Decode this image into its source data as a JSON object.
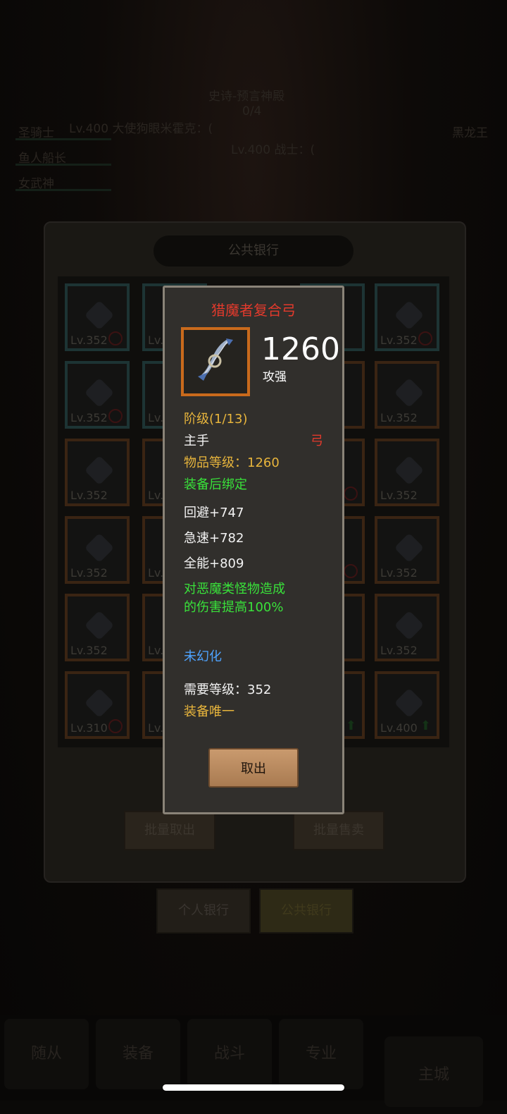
{
  "background": {
    "dungeon_title": "史诗-预言神殿",
    "dungeon_progress": "0/4",
    "boss_line_1": "Lv.400 大使狗眼米霍克：(",
    "boss_line_2": "Lv.400 战士：(",
    "right_label": "黑龙王",
    "party": [
      "圣骑士",
      "鱼人船长",
      "女武神"
    ]
  },
  "bank": {
    "title": "公共银行",
    "cells": [
      {
        "lv": "Lv.352",
        "ban": true,
        "border": "teal"
      },
      {
        "lv": "Lv.352",
        "ban": true,
        "border": "teal"
      },
      {
        "lv": "Lv.352",
        "ban": true,
        "border": "teal"
      },
      {
        "lv": "Lv.352",
        "ban": false,
        "border": "orange"
      },
      {
        "lv": "Lv.352",
        "ban": false,
        "border": "orange"
      },
      {
        "lv": "Lv.352",
        "ban": false,
        "border": "orange"
      },
      {
        "lv": "Lv.352",
        "ban": false,
        "border": "orange"
      },
      {
        "lv": "Lv.352",
        "ban": false,
        "border": "orange"
      },
      {
        "lv": "Lv.352",
        "ban": false,
        "border": "orange"
      },
      {
        "lv": "Lv.352",
        "ban": false,
        "border": "orange"
      },
      {
        "lv": "Lv.310",
        "ban": true,
        "border": "teal"
      },
      {
        "lv": "Lv.400",
        "ban": false,
        "border": "orange",
        "up": true
      }
    ],
    "cell_partial_label": "Lv.",
    "batch_take": "批量取出",
    "batch_sell": "批量售卖"
  },
  "tabs": {
    "personal_bank": "个人银行",
    "public_bank": "公共银行"
  },
  "nav": [
    "随从",
    "装备",
    "战斗",
    "专业",
    "主城"
  ],
  "tooltip": {
    "item_name": "猎魔者复合弓",
    "power_value": "1260",
    "power_label": "攻强",
    "tier": "阶级(1/13)",
    "slot": "主手",
    "weapon_type": "弓",
    "item_level": "物品等级：1260",
    "bind": "装备后绑定",
    "stats": [
      "回避+747",
      "急速+782",
      "全能+809"
    ],
    "effect_line1": "对恶魔类怪物造成",
    "effect_line2": "的伤害提高100%",
    "transmog": "未幻化",
    "required_level": "需要等级：352",
    "unique": "装备唯一",
    "take_out": "取出"
  },
  "colors": {
    "title_red": "#e23a2c",
    "gold": "#e8b53c",
    "green": "#39e23a",
    "blue": "#4ea3ff",
    "frame_orange": "#c96a1c"
  }
}
